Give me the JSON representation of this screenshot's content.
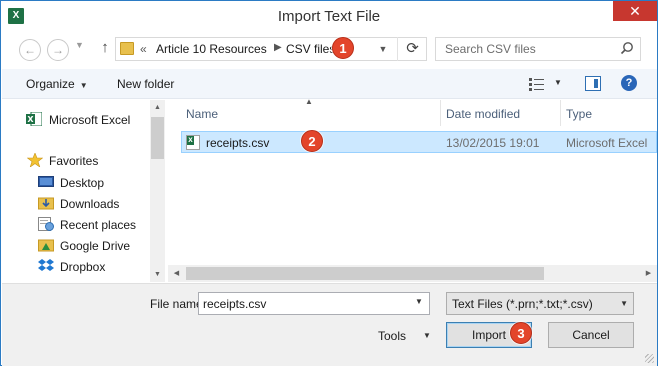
{
  "window": {
    "title": "Import Text File",
    "app_icon": "excel-icon",
    "close_glyph": "✕"
  },
  "address_bar": {
    "overflow_glyph": "«",
    "crumbs": [
      "Article 10 Resources",
      "CSV files"
    ],
    "search_placeholder": "Search CSV files"
  },
  "toolbar": {
    "organize_label": "Organize",
    "new_folder_label": "New folder"
  },
  "nav_pane": {
    "items": [
      {
        "label": "Microsoft Excel",
        "icon": "excel-icon"
      },
      {
        "label": "Favorites",
        "icon": "star-icon"
      },
      {
        "label": "Desktop",
        "icon": "desktop-icon"
      },
      {
        "label": "Downloads",
        "icon": "downloads-icon"
      },
      {
        "label": "Recent places",
        "icon": "recent-places-icon"
      },
      {
        "label": "Google Drive",
        "icon": "google-drive-icon"
      },
      {
        "label": "Dropbox",
        "icon": "dropbox-icon"
      }
    ]
  },
  "file_list": {
    "columns": [
      "Name",
      "Date modified",
      "Type"
    ],
    "rows": [
      {
        "name": "receipts.csv",
        "date": "13/02/2015 19:01",
        "type": "Microsoft Excel"
      }
    ]
  },
  "footer": {
    "file_name_label": "File name:",
    "file_name_value": "receipts.csv",
    "file_type": "Text Files (*.prn;*.txt;*.csv)",
    "tools_label": "Tools",
    "import_label": "Import",
    "cancel_label": "Cancel"
  },
  "markers": [
    "1",
    "2",
    "3"
  ],
  "colors": {
    "marker": "#e3452b",
    "selection": "#cce8ff",
    "close": "#c7372f",
    "excel_green": "#1e7145"
  }
}
